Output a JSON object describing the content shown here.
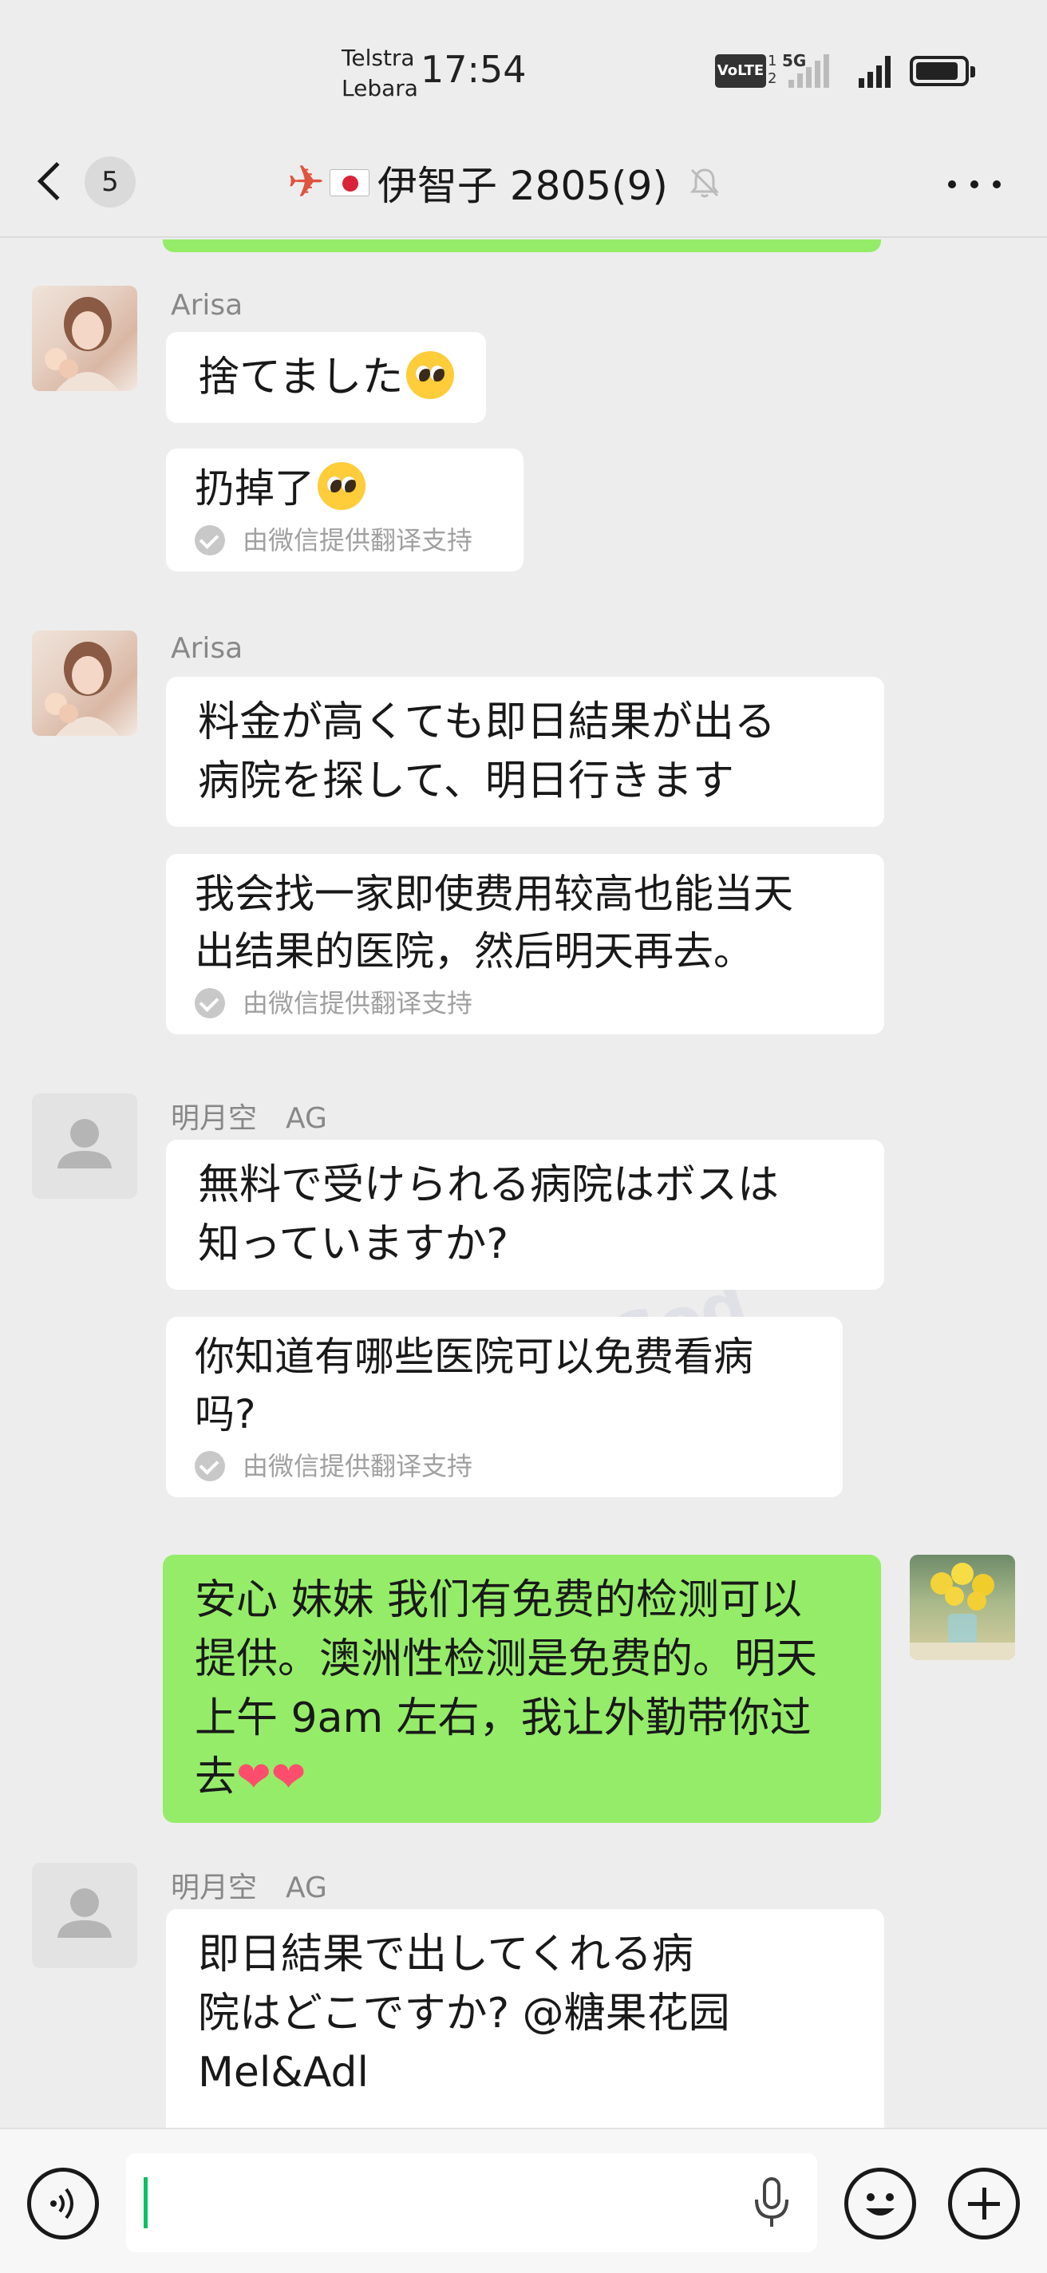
{
  "status_bar": {
    "carrier_1": "Telstra",
    "carrier_2": "Lebara",
    "time": "17:54",
    "volte": "VoLTE",
    "sim_1": "1",
    "sim_2": "2",
    "network": "5G",
    "battery_level": 0.9
  },
  "header": {
    "back_count": "5",
    "title": "伊智子 2805(9)",
    "title_icons": [
      "airplane-icon",
      "japan-flag-icon"
    ],
    "muted": true
  },
  "messages": [
    {
      "sender": "Arisa",
      "text": "捨てました",
      "emoji": "pleading-face",
      "translation": "扔掉了",
      "translation_emoji": "pleading-face",
      "translation_note": "由微信提供翻译支持"
    },
    {
      "sender": "Arisa",
      "text_lines": [
        "料金が高くても即日結果が出る",
        "病院を探して、明日行きます"
      ],
      "translation_lines": [
        "我会找一家即使费用较高也能当天",
        "出结果的医院，然后明天再去。"
      ],
      "translation_note": "由微信提供翻译支持"
    },
    {
      "sender": "明月空　AG",
      "text_lines": [
        "無料で受けられる病院はボスは",
        "知っていますか?"
      ],
      "translation_lines": [
        "你知道有哪些医院可以免费看病",
        "吗?"
      ],
      "translation_note": "由微信提供翻译支持"
    },
    {
      "sender": "me",
      "text_lines": [
        "安心 妹妹 我们有免费的检测可以",
        "提供。澳洲性检测是免费的。明天",
        "上午 9am 左右，我让外勤带你过",
        "去"
      ],
      "emoji": "red-heart x2"
    },
    {
      "sender": "明月空　AG",
      "text_lines": [
        "即日結果で出してくれる病",
        "院はどこですか? @糖果花园",
        "Mel&Adl"
      ]
    }
  ],
  "watermark": "CatchGod",
  "input": {
    "value": "",
    "placeholder": ""
  }
}
